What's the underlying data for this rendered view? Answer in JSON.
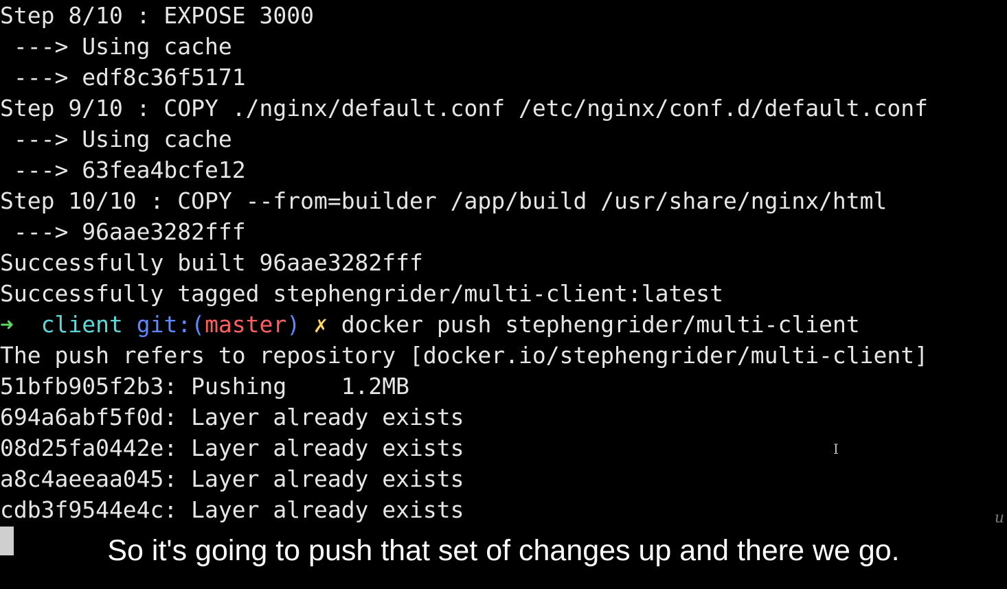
{
  "terminal": {
    "lines": [
      "Step 8/10 : EXPOSE 3000",
      " ---> Using cache",
      " ---> edf8c36f5171",
      "Step 9/10 : COPY ./nginx/default.conf /etc/nginx/conf.d/default.conf",
      " ---> Using cache",
      " ---> 63fea4bcfe12",
      "Step 10/10 : COPY --from=builder /app/build /usr/share/nginx/html",
      " ---> 96aae3282fff",
      "Successfully built 96aae3282fff",
      "Successfully tagged stephengrider/multi-client:latest"
    ],
    "prompt": {
      "arrow": "➜",
      "dir": "client",
      "git_prefix": "git:(",
      "branch": "master",
      "git_suffix": ")",
      "dirty_mark": "✗",
      "command": "docker push stephengrider/multi-client"
    },
    "output": [
      "The push refers to repository [docker.io/stephengrider/multi-client]",
      "51bfb905f2b3: Pushing    1.2MB",
      "694a6abf5f0d: Layer already exists",
      "08d25fa0442e: Layer already exists",
      "a8c4aeeaa045: Layer already exists",
      "cdb3f9544e4c: Layer already exists"
    ]
  },
  "overlay": {
    "ibeam_glyph": "I",
    "corner_mark": "u"
  },
  "caption": "So it's going to push that set of changes up and there we go.",
  "colors": {
    "background": "#000000",
    "text": "#e6e6e6",
    "prompt_arrow": "#5fd75f",
    "prompt_dir": "#5fd7d7",
    "prompt_git": "#5f87ff",
    "prompt_branch": "#ff5f5f",
    "prompt_dirty": "#ffd75f"
  }
}
